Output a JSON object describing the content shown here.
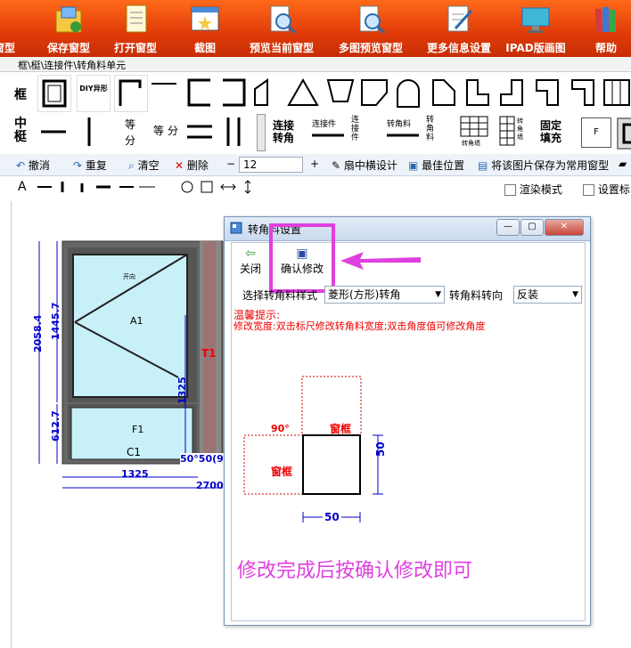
{
  "ribbon": {
    "buttons": [
      {
        "label": "窗型",
        "icon": "partial-icon"
      },
      {
        "label": "保存窗型",
        "icon": "save-folder-icon"
      },
      {
        "label": "打开窗型",
        "icon": "open-document-icon"
      },
      {
        "label": "截图",
        "icon": "screenshot-icon"
      },
      {
        "label": "预览当前窗型",
        "icon": "magnifier-icon"
      },
      {
        "label": "多图预览窗型",
        "icon": "magnifier-document-icon"
      },
      {
        "label": "更多信息设置",
        "icon": "edit-document-icon"
      },
      {
        "label": "IPAD版画图",
        "icon": "monitor-icon"
      },
      {
        "label": "帮助",
        "icon": "books-icon"
      }
    ]
  },
  "tabstrip": {
    "label": "框\\梃\\连接件\\转角料单元"
  },
  "rows": {
    "frame_label": "框",
    "mullion_label": "中梃",
    "diy_label": "DIY异形",
    "mullion_items": [
      "等分",
      "等",
      "分"
    ],
    "connector_items": [
      "连接转角",
      "连接件",
      "连接件",
      "转角料",
      "转角料",
      "转角墙",
      "转角墙"
    ],
    "fixed_fill": "固定填充",
    "f_label": "F"
  },
  "toolbar": {
    "undo": "撤消",
    "redo": "重复",
    "clear": "清空",
    "delete": "删除",
    "minus": "−",
    "size_value": "12",
    "plus": "+",
    "fan_design": "扇中横设计",
    "best_position": "最佳位置",
    "save_common": "将该图片保存为常用窗型"
  },
  "toolbar2": {
    "text_tool": "A",
    "render_mode": "渲染模式",
    "set_label": "设置标"
  },
  "drawing": {
    "dim_total_height": "2058.4",
    "dim_upper_height": "1445.7",
    "dim_lower_height": "612.7",
    "dim_inner_height": "1325",
    "dim_width_1": "1325",
    "dim_width_total": "2700",
    "label_a1": "A1",
    "label_f1": "F1",
    "label_c1": "C1",
    "label_t1": "T1",
    "label_50": "50°50(90",
    "sash_hint": "开向"
  },
  "dialog": {
    "title": "转角料设置",
    "close_btn": "关闭",
    "confirm_btn": "确认修改",
    "style_label": "选择转角料样式",
    "style_value": "菱形(方形)转角",
    "direction_label": "转角料转向",
    "direction_value": "反装",
    "tip_title": "温馨提示:",
    "tip_text": "修改宽度:双击标尺修改转角料宽度;双击角度值可修改角度",
    "angle": "90°",
    "frame_top": "窗框",
    "frame_left": "窗框",
    "dim_right": "50",
    "dim_bottom": "50",
    "instruction": "修改完成后按确认修改即可"
  },
  "colors": {
    "ribbon": "#e8470e",
    "highlight": "#e040e0",
    "red_text": "#e00000",
    "dim_blue": "#0000cc",
    "glass": "#c8f0f8"
  }
}
